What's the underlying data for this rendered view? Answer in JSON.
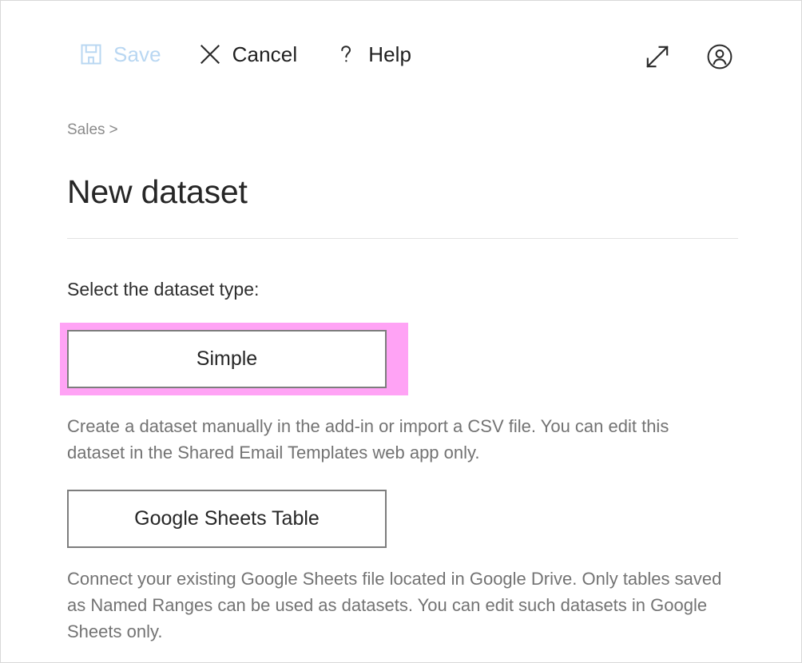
{
  "colors": {
    "highlight_pink": "#ffa3f5",
    "disabled_blue": "#b9d7f2",
    "text_dark": "#262626",
    "text_gray": "#737373",
    "border_gray": "#7d7d7d",
    "frame_gray": "#d8d8d8"
  },
  "commandbar": {
    "items": [
      {
        "id": "save",
        "label": "Save",
        "icon": "save-icon",
        "disabled": true
      },
      {
        "id": "cancel",
        "label": "Cancel",
        "icon": "cancel-icon",
        "disabled": false
      },
      {
        "id": "help",
        "label": "Help",
        "icon": "help-icon",
        "disabled": false
      }
    ],
    "right_items": [
      {
        "id": "expand",
        "icon": "expand-diagonal-icon"
      },
      {
        "id": "account",
        "icon": "account-circle-icon"
      }
    ]
  },
  "breadcrumb": {
    "parent": "Sales",
    "separator": ">"
  },
  "page": {
    "title": "New dataset",
    "section_label": "Select the dataset type:"
  },
  "options": [
    {
      "id": "simple",
      "label": "Simple",
      "highlighted": true,
      "description": "Create a dataset manually in the add-in or import a CSV file. You can edit this dataset in the Shared Email Templates web app only."
    },
    {
      "id": "google-sheets-table",
      "label": "Google Sheets Table",
      "highlighted": false,
      "description": "Connect your existing Google Sheets file located in Google Drive. Only tables saved as Named Ranges can be used as datasets. You can edit such datasets in Google Sheets only."
    }
  ]
}
